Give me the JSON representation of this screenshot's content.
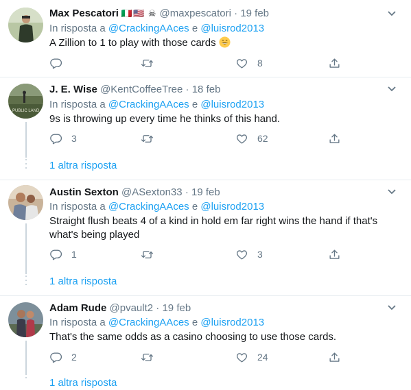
{
  "tweets": [
    {
      "name": "Max Pescatori",
      "flags": "🇮🇹🇺🇸 ☠",
      "handle": "@maxpescatori",
      "dot": "·",
      "date": "19 feb",
      "reply_prefix": "In risposta a",
      "reply_user1": "@CrackingAAces",
      "reply_and": "e",
      "reply_user2": "@luisrod2013",
      "text": "A Zillion to 1 to play with those cards",
      "emoji_icon": "grinning-face-icon",
      "replies": "",
      "retweets": "",
      "likes": "8"
    },
    {
      "name": "J. E. Wise",
      "handle": "@KentCoffeeTree",
      "dot": "·",
      "date": "18 feb",
      "reply_prefix": "In risposta a",
      "reply_user1": "@CrackingAAces",
      "reply_and": "e",
      "reply_user2": "@luisrod2013",
      "text": "9s is throwing up every time he thinks of this hand.",
      "replies": "3",
      "retweets": "",
      "likes": "62",
      "more_replies": "1 altra risposta"
    },
    {
      "name": "Austin Sexton",
      "handle": "@ASexton33",
      "dot": "·",
      "date": "19 feb",
      "reply_prefix": "In risposta a",
      "reply_user1": "@CrackingAAces",
      "reply_and": "e",
      "reply_user2": "@luisrod2013",
      "text": "Straight flush beats 4 of a kind in hold em far right wins the hand if that's what's being played",
      "replies": "1",
      "retweets": "",
      "likes": "3",
      "more_replies": "1 altra risposta"
    },
    {
      "name": "Adam Rude",
      "handle": "@pvault2",
      "dot": "·",
      "date": "19 feb",
      "reply_prefix": "In risposta a",
      "reply_user1": "@CrackingAAces",
      "reply_and": "e",
      "reply_user2": "@luisrod2013",
      "text": "That's the same odds as a casino choosing to use those cards.",
      "replies": "2",
      "retweets": "",
      "likes": "24",
      "more_replies": "1 altra risposta"
    }
  ],
  "colors": {
    "link": "#1da1f2",
    "secondary_text": "#657786",
    "primary_text": "#14171a",
    "separator": "#e6ecf0",
    "thread_line": "#ccd6dd"
  },
  "icons": {
    "reply": "reply-icon",
    "retweet": "retweet-icon",
    "like": "heart-icon",
    "share": "share-icon",
    "menu": "chevron-down-icon"
  }
}
